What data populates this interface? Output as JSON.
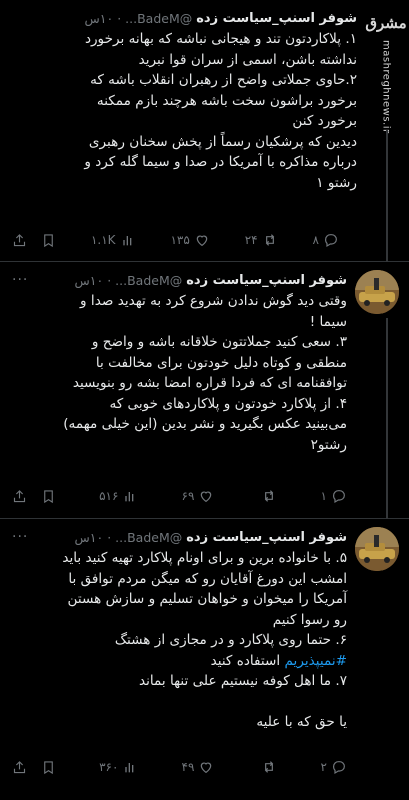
{
  "watermark": {
    "mark": "مشرق",
    "url": "mashreghnews.ir"
  },
  "tweets": [
    {
      "name": "شوفر اسنپ_سیاست زده",
      "handle": "@BadeM...",
      "time": "۱۰س",
      "lines": [
        "۱. پلاکاردتون تند و هیجانی نباشه که بهانه برخورد",
        "نداشته باشن، اسمی از سران قوا نبرید",
        "۲.حاوی جملاتی واضح از رهبران انقلاب باشه که",
        "برخورد براشون سخت باشه هرچند بازم ممکنه",
        "برخورد کنن",
        "دیدین که پرشکیان رسماً از پخش سخنان رهبری",
        "درباره مذاکره با آمریکا در صدا و سیما گله کرد و",
        "رشتو ۱"
      ],
      "replies": "۸",
      "retweets": "۲۴",
      "likes": "۱۳۵",
      "views": "۱.۱K"
    },
    {
      "name": "شوفر اسنپ_سیاست زده",
      "handle": "@BadeM...",
      "time": "۱۰س",
      "lines": [
        "وقتی دید گوش ندادن شروع کرد به تهدید صدا و",
        "سیما !",
        "۳. سعی کنید جملاتتون خلاقانه باشه و واضح و",
        "منطقی و کوتاه دلیل خودتون برای مخالفت با",
        "توافقنامه ای که فردا قراره امضا بشه رو بنویسید",
        "۴. از پلاکارد خودتون و پلاکاردهای خوبی که",
        "می‌بینید عکس بگیرید و نشر بدین (این خیلی مهمه)",
        "رشتو۲"
      ],
      "replies": "۱",
      "retweets": "",
      "likes": "۶۹",
      "views": "۵۱۶"
    },
    {
      "name": "شوفر اسنپ_سیاست زده",
      "handle": "@BadeM...",
      "time": "۱۰س",
      "lines": [
        "۵. با خانواده برین و برای اونام پلاکارد تهیه کنید باید",
        "امشب این دورغ آقایان رو که میگن مردم توافق با",
        "آمریکا را میخوان و خواهان تسلیم و سازش هستن",
        "رو رسوا کنیم",
        "۶. حتما روی پلاکارد و در مجازی از هشتگ"
      ],
      "hashtag": "#نمیپذیریم",
      "hashtag_suffix": " استفاده کنید",
      "lines_after": [
        "۷. ما اهل کوفه نیستیم علی تنها بماند",
        "",
        "یا حق که با علیه"
      ],
      "replies": "۲",
      "retweets": "",
      "likes": "۴۹",
      "views": "۳۶۰"
    }
  ]
}
